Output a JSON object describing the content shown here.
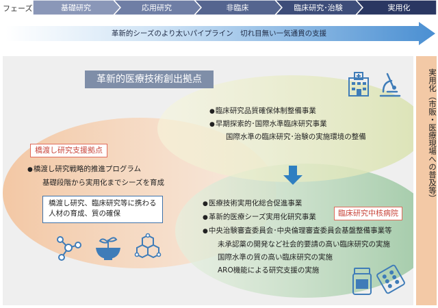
{
  "phases": {
    "label": "フェーズ",
    "items": [
      {
        "name": "基礎研究",
        "color": "#8a97b8"
      },
      {
        "name": "応用研究",
        "color": "#6f7ea5"
      },
      {
        "name": "非臨床",
        "color": "#55658f"
      },
      {
        "name": "臨床研究･治験",
        "color": "#3d4d79"
      },
      {
        "name": "実用化",
        "color": "#2a3762"
      }
    ]
  },
  "pipeline": {
    "text": "革新的シーズのより太いパイプライン　切れ目無い一気通貫の支援"
  },
  "hub_title": "革新的医療技術創出拠点",
  "bridge": {
    "label": "橋渡し研究支援拠点",
    "items": [
      {
        "bullet": true,
        "text": "橋渡し研究戦略的推進プログラム"
      },
      {
        "bullet": false,
        "text": "基礎段階から実用化までシーズを育成"
      }
    ],
    "training": [
      "橋渡し研究、臨床研究等に携わる",
      "人材の育成、質の確保"
    ]
  },
  "quality": {
    "items": [
      {
        "bullet": true,
        "text": "臨床研究品質確保体制整備事業"
      },
      {
        "bullet": true,
        "text": "早期探索的･国際水準臨床研究事業"
      },
      {
        "bullet": false,
        "text": "国際水準の臨床研究･治験の実施環境の整備"
      }
    ]
  },
  "core": {
    "label": "臨床研究中核病院",
    "items": [
      {
        "bullet": true,
        "text": "医療技術実用化総合促進事業"
      },
      {
        "bullet": true,
        "text": "革新的医療シーズ実用化研究事業"
      },
      {
        "bullet": true,
        "text": "中央治験審査委員会･中央倫理審査委員会基盤整備事業等"
      },
      {
        "bullet": false,
        "text": "未承認薬の開発など社会的要請の高い臨床研究の実施"
      },
      {
        "bullet": false,
        "text": "国際水準の質の高い臨床研究の実施"
      },
      {
        "bullet": false,
        "text": "ARO機能による研究支援の実施"
      }
    ]
  },
  "side": {
    "text": "実用化（市販・医療現場への普及等）"
  },
  "colors": {
    "pipeline_arrow": "#5b9ad6",
    "bridge_ellipse": "#f6d3b6",
    "quality_ellipse": "#ecebc2",
    "core_ellipse": "#bcd7be",
    "down_arrow": "#2f7fc1",
    "icon_blue": "#3f7cb8"
  }
}
